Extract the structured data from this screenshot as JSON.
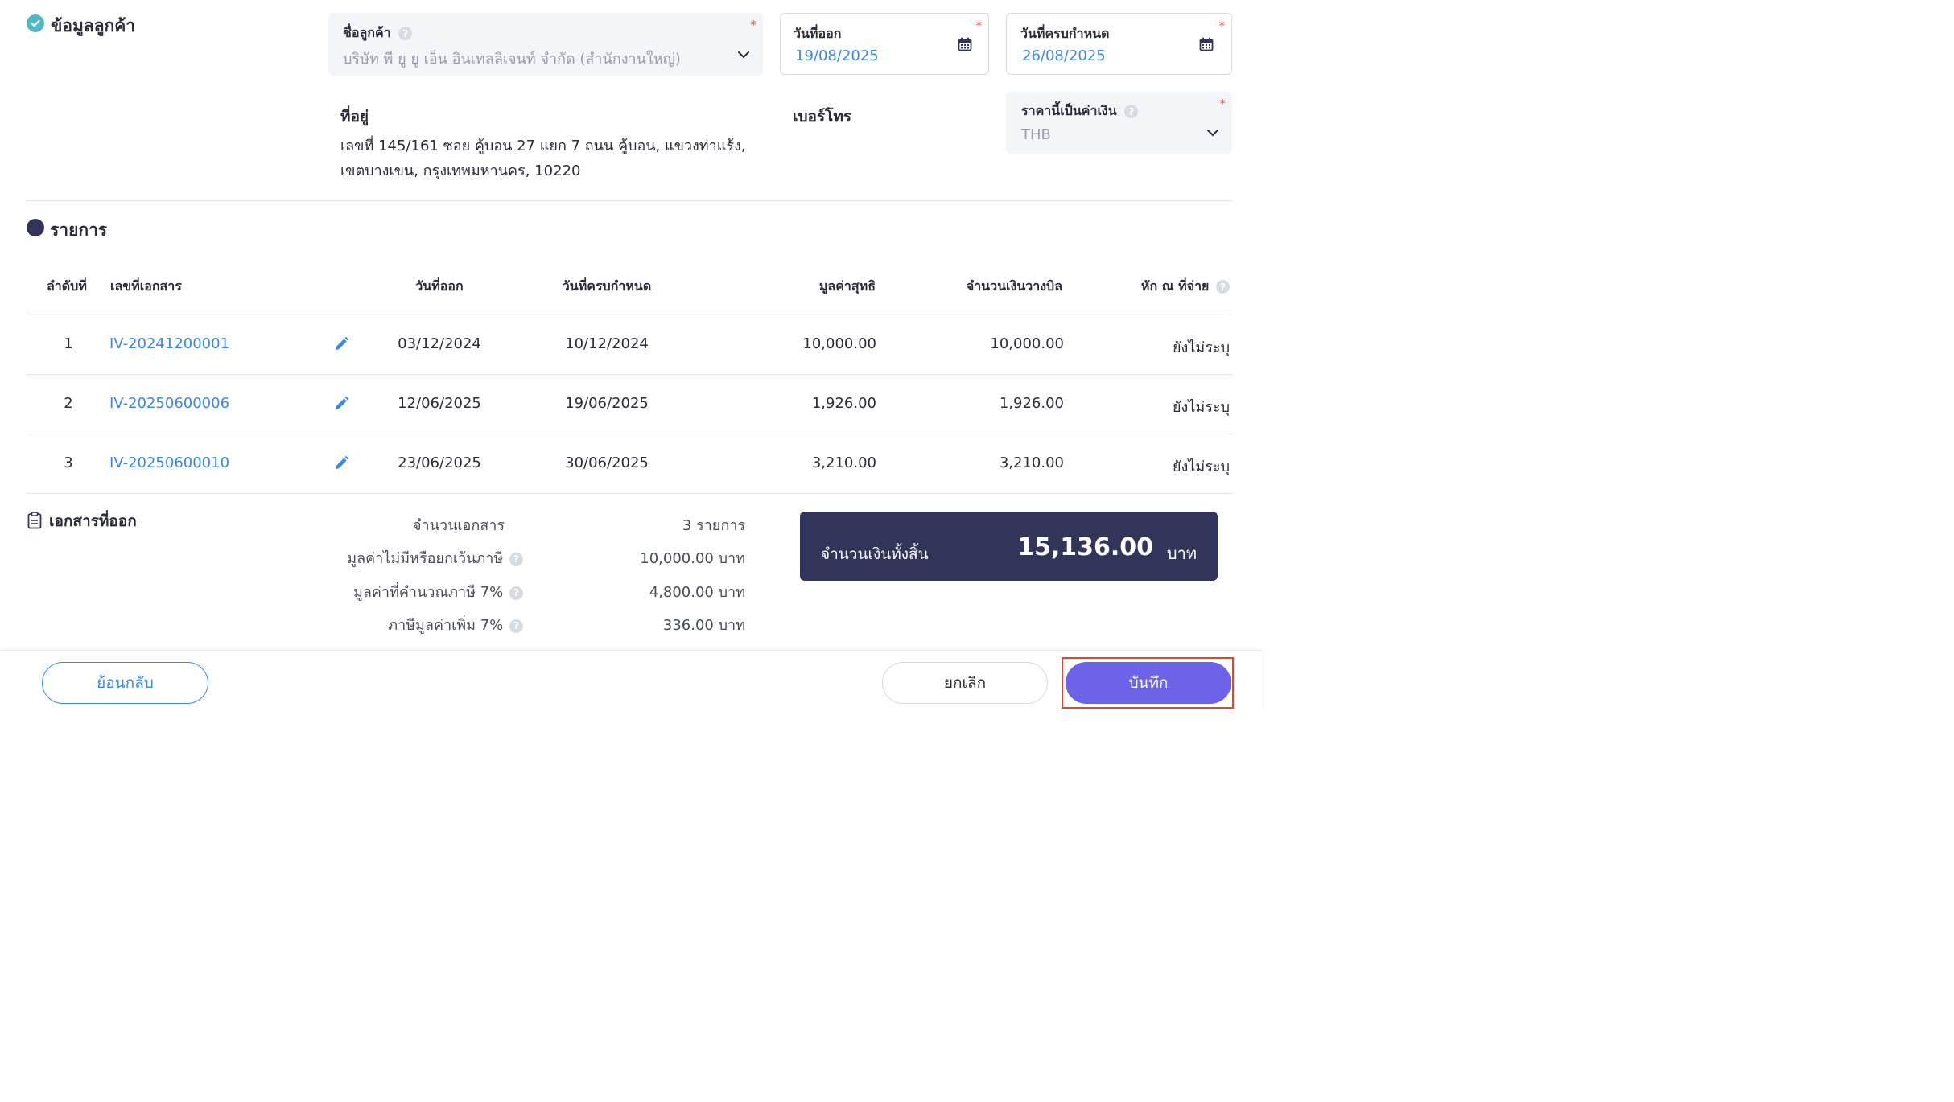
{
  "customer_section": {
    "title": "ข้อมูลลูกค้า",
    "customer_name_label": "ชื่อลูกค้า",
    "customer_name_value": "บริษัท พี ยู ยู เอ็น อินเทลลิเจนท์ จำกัด (สำนักงานใหญ่)",
    "issue_date_label": "วันที่ออก",
    "issue_date_value": "19/08/2025",
    "due_date_label": "วันที่ครบกำหนด",
    "due_date_value": "26/08/2025",
    "address_label": "ที่อยู่",
    "address_line1": "เลขที่ 145/161 ซอย คู้บอน 27 แยก 7 ถนน คู้บอน, แขวงท่าแร้ง,",
    "address_line2": "เขตบางเขน, กรุงเทพมหานคร, 10220",
    "phone_label": "เบอร์โทร",
    "currency_label": "ราคานี้เป็นค่าเงิน",
    "currency_value": "THB",
    "required_mark": "*",
    "help_mark": "?"
  },
  "items_section": {
    "title": "รายการ",
    "columns": [
      "ลำดับที่",
      "เลขที่เอกสาร",
      "วันที่ออก",
      "วันที่ครบกำหนด",
      "มูลค่าสุทธิ",
      "จำนวนเงินวางบิล",
      "หัก ณ ที่จ่าย"
    ],
    "rows": [
      {
        "no": "1",
        "doc": "IV-20241200001",
        "issue": "03/12/2024",
        "due": "10/12/2024",
        "net": "10,000.00",
        "bill": "10,000.00",
        "wht": "ยังไม่ระบุ"
      },
      {
        "no": "2",
        "doc": "IV-20250600006",
        "issue": "12/06/2025",
        "due": "19/06/2025",
        "net": "1,926.00",
        "bill": "1,926.00",
        "wht": "ยังไม่ระบุ"
      },
      {
        "no": "3",
        "doc": "IV-20250600010",
        "issue": "23/06/2025",
        "due": "30/06/2025",
        "net": "3,210.00",
        "bill": "3,210.00",
        "wht": "ยังไม่ระบุ"
      }
    ]
  },
  "summary_section": {
    "title": "เอกสารที่ออก",
    "doc_count_label": "จำนวนเอกสาร",
    "doc_count_value": "3 รายการ",
    "non_vat_label": "มูลค่าไม่มีหรือยกเว้นภาษี",
    "non_vat_value": "10,000.00 บาท",
    "vatable_label": "มูลค่าที่คำนวณภาษี 7%",
    "vatable_value": "4,800.00 บาท",
    "vat_label": "ภาษีมูลค่าเพิ่ม 7%",
    "vat_value": "336.00 บาท",
    "total_label": "จำนวนเงินทั้งสิ้น",
    "total_value": "15,136.00",
    "total_unit": "บาท"
  },
  "bottom_bar": {
    "back_label": "ย้อนกลับ",
    "cancel_label": "ยกเลิก",
    "save_label": "บันทึก"
  },
  "colors": {
    "accent": "#6c63e8",
    "link": "#3a88e4",
    "dark_panel": "#33345a",
    "highlight": "#e0452f"
  }
}
